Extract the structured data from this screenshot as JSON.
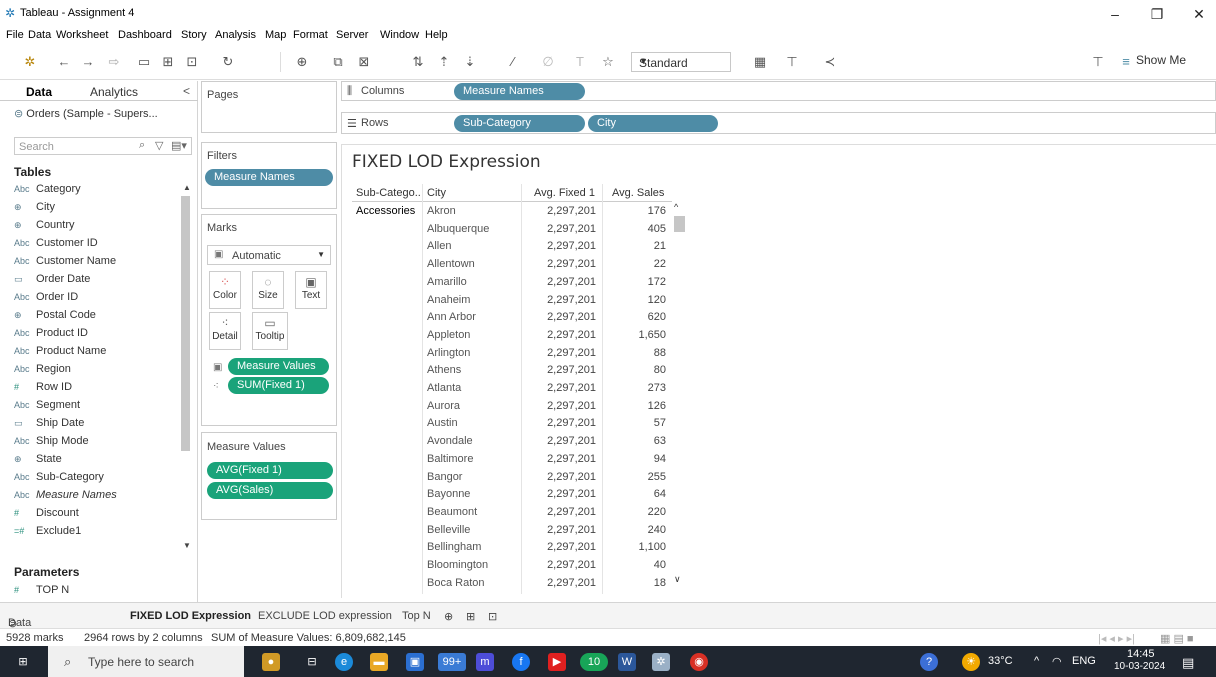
{
  "window": {
    "title": "Tableau - Assignment 4",
    "min": "–",
    "max": "❐",
    "close": "✕"
  },
  "menu": [
    "File",
    "Data",
    "Worksheet",
    "Dashboard",
    "Story",
    "Analysis",
    "Map",
    "Format",
    "Server",
    "Window",
    "Help"
  ],
  "toolbar": {
    "fit_label": "Standard",
    "show_me": "Show Me"
  },
  "data_pane": {
    "tab_data": "Data",
    "tab_analytics": "Analytics",
    "collapse": "<",
    "datasource": "Orders (Sample - Supers...",
    "search_placeholder": "Search",
    "tables_header": "Tables",
    "fields": [
      {
        "type": "Abc",
        "name": "Category"
      },
      {
        "type": "⊕",
        "name": "City"
      },
      {
        "type": "⊕",
        "name": "Country"
      },
      {
        "type": "Abc",
        "name": "Customer ID"
      },
      {
        "type": "Abc",
        "name": "Customer Name"
      },
      {
        "type": "▭",
        "name": "Order Date"
      },
      {
        "type": "Abc",
        "name": "Order ID"
      },
      {
        "type": "⊕",
        "name": "Postal Code"
      },
      {
        "type": "Abc",
        "name": "Product ID"
      },
      {
        "type": "Abc",
        "name": "Product Name"
      },
      {
        "type": "Abc",
        "name": "Region"
      },
      {
        "type": "#",
        "name": "Row ID"
      },
      {
        "type": "Abc",
        "name": "Segment"
      },
      {
        "type": "▭",
        "name": "Ship Date"
      },
      {
        "type": "Abc",
        "name": "Ship Mode"
      },
      {
        "type": "⊕",
        "name": "State"
      },
      {
        "type": "Abc",
        "name": "Sub-Category"
      },
      {
        "type": "Abc",
        "name": "Measure Names"
      },
      {
        "type": "#",
        "name": "Discount"
      },
      {
        "type": "=#",
        "name": "Exclude1"
      }
    ],
    "parameters_header": "Parameters",
    "parameters": [
      {
        "type": "#",
        "name": "TOP N"
      }
    ]
  },
  "shelves": {
    "pages": "Pages",
    "columns_label": "Columns",
    "rows_label": "Rows",
    "columns_pill": "Measure Names",
    "rows_pills": [
      "Sub-Category",
      "City"
    ],
    "filters": "Filters",
    "filter_pill": "Measure Names",
    "marks": "Marks",
    "marks_type": "Automatic",
    "mark_buttons": [
      "Color",
      "Size",
      "Text",
      "Detail",
      "Tooltip"
    ],
    "marks_pills": [
      "Measure Values",
      "SUM(Fixed 1)"
    ],
    "measure_values": "Measure Values",
    "mv_pills": [
      "AVG(Fixed 1)",
      "AVG(Sales)"
    ]
  },
  "view": {
    "title": "FIXED LOD Expression",
    "headers": [
      "Sub-Catego..",
      "City",
      "Avg. Fixed 1",
      "Avg. Sales"
    ],
    "sub_category": "Accessories",
    "rows": [
      {
        "city": "Akron",
        "fixed": "2,297,201",
        "sales": "176"
      },
      {
        "city": "Albuquerque",
        "fixed": "2,297,201",
        "sales": "405"
      },
      {
        "city": "Allen",
        "fixed": "2,297,201",
        "sales": "21"
      },
      {
        "city": "Allentown",
        "fixed": "2,297,201",
        "sales": "22"
      },
      {
        "city": "Amarillo",
        "fixed": "2,297,201",
        "sales": "172"
      },
      {
        "city": "Anaheim",
        "fixed": "2,297,201",
        "sales": "120"
      },
      {
        "city": "Ann Arbor",
        "fixed": "2,297,201",
        "sales": "620"
      },
      {
        "city": "Appleton",
        "fixed": "2,297,201",
        "sales": "1,650"
      },
      {
        "city": "Arlington",
        "fixed": "2,297,201",
        "sales": "88"
      },
      {
        "city": "Athens",
        "fixed": "2,297,201",
        "sales": "80"
      },
      {
        "city": "Atlanta",
        "fixed": "2,297,201",
        "sales": "273"
      },
      {
        "city": "Aurora",
        "fixed": "2,297,201",
        "sales": "126"
      },
      {
        "city": "Austin",
        "fixed": "2,297,201",
        "sales": "57"
      },
      {
        "city": "Avondale",
        "fixed": "2,297,201",
        "sales": "63"
      },
      {
        "city": "Baltimore",
        "fixed": "2,297,201",
        "sales": "94"
      },
      {
        "city": "Bangor",
        "fixed": "2,297,201",
        "sales": "255"
      },
      {
        "city": "Bayonne",
        "fixed": "2,297,201",
        "sales": "64"
      },
      {
        "city": "Beaumont",
        "fixed": "2,297,201",
        "sales": "220"
      },
      {
        "city": "Belleville",
        "fixed": "2,297,201",
        "sales": "240"
      },
      {
        "city": "Bellingham",
        "fixed": "2,297,201",
        "sales": "1,100"
      },
      {
        "city": "Bloomington",
        "fixed": "2,297,201",
        "sales": "40"
      },
      {
        "city": "Boca Raton",
        "fixed": "2,297,201",
        "sales": "18"
      }
    ]
  },
  "sheet_tabs": [
    "Data Source",
    "FIXED LOD Expression",
    "EXCLUDE LOD expression",
    "Top N"
  ],
  "status": {
    "marks": "5928 marks",
    "rows": "2964 rows by 2 columns",
    "sum": "SUM of Measure Values: 6,809,682,145"
  },
  "taskbar": {
    "search_placeholder": "Type here to search",
    "temp": "33°C",
    "lang": "ENG",
    "time": "14:45",
    "date": "10-03-2024",
    "badge_a": "99+",
    "badge_b": "10"
  },
  "colors": {
    "pill_green": "#1aa37a",
    "pill_blue": "#4e8ca6",
    "taskbar": "#1f2630"
  }
}
